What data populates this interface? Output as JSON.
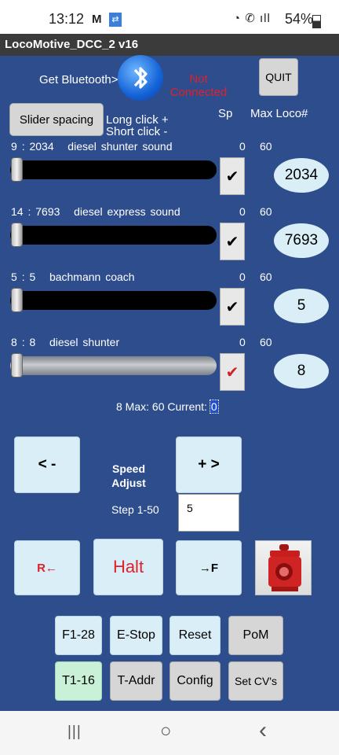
{
  "status_bar": {
    "time": "13:12",
    "mail_icon": "M",
    "signal_text": "ıll",
    "battery": "54%"
  },
  "app": {
    "title": "LocoMotive_DCC_2 v16"
  },
  "bluetooth": {
    "label": "Get Bluetooth>",
    "status": "Not Connected",
    "status_color": "#e0202a"
  },
  "quit_label": "QUIT",
  "slider_spacing_label": "Slider spacing",
  "click_hint_1": "Long click +",
  "click_hint_2": "Short click -",
  "headers": {
    "sp": "Sp",
    "max_loco": "Max Loco#"
  },
  "locos": [
    {
      "index": "9",
      "sep": ":",
      "address": "2034",
      "name": "diesel shunter sound",
      "speed": "0",
      "max": "60",
      "loco_number": "2034",
      "speed_fraction": 0,
      "track": "black",
      "check_color": "#000000"
    },
    {
      "index": "14",
      "sep": ":",
      "address": "7693",
      "name": "diesel express sound",
      "speed": "0",
      "max": "60",
      "loco_number": "7693",
      "speed_fraction": 0,
      "track": "black",
      "check_color": "#000000"
    },
    {
      "index": "5",
      "sep": ":",
      "address": "5",
      "name": "bachmann coach",
      "speed": "0",
      "max": "60",
      "loco_number": "5",
      "speed_fraction": 0,
      "track": "black",
      "check_color": "#000000"
    },
    {
      "index": "8",
      "sep": ":",
      "address": "8",
      "name": "diesel shunter",
      "speed": "0",
      "max": "60",
      "loco_number": "8",
      "speed_fraction": 0,
      "track": "grey",
      "check_color": "#d0202a"
    }
  ],
  "checkmark": "✔",
  "summary": {
    "text": "8 Max: 60 Current: ",
    "current": "0"
  },
  "speed_controls": {
    "minus": "< -",
    "plus": "+ >",
    "adjust_line1": "Speed",
    "adjust_line2": "Adjust",
    "step_label": "Step 1-50",
    "step_value": "5"
  },
  "direction": {
    "reverse": "R←",
    "halt": "Halt",
    "forward": "→F"
  },
  "bottom_buttons": {
    "f128": "F1-28",
    "estop": "E-Stop",
    "reset": "Reset",
    "pom": "PoM",
    "t116": "T1-16",
    "taddr": "T-Addr",
    "config": "Config",
    "setcv": "Set CV's"
  },
  "nav": {
    "recent": "|||",
    "home": "○",
    "back": "‹"
  },
  "colors": {
    "background": "#2e4d8c",
    "accent_red": "#e0202a"
  }
}
